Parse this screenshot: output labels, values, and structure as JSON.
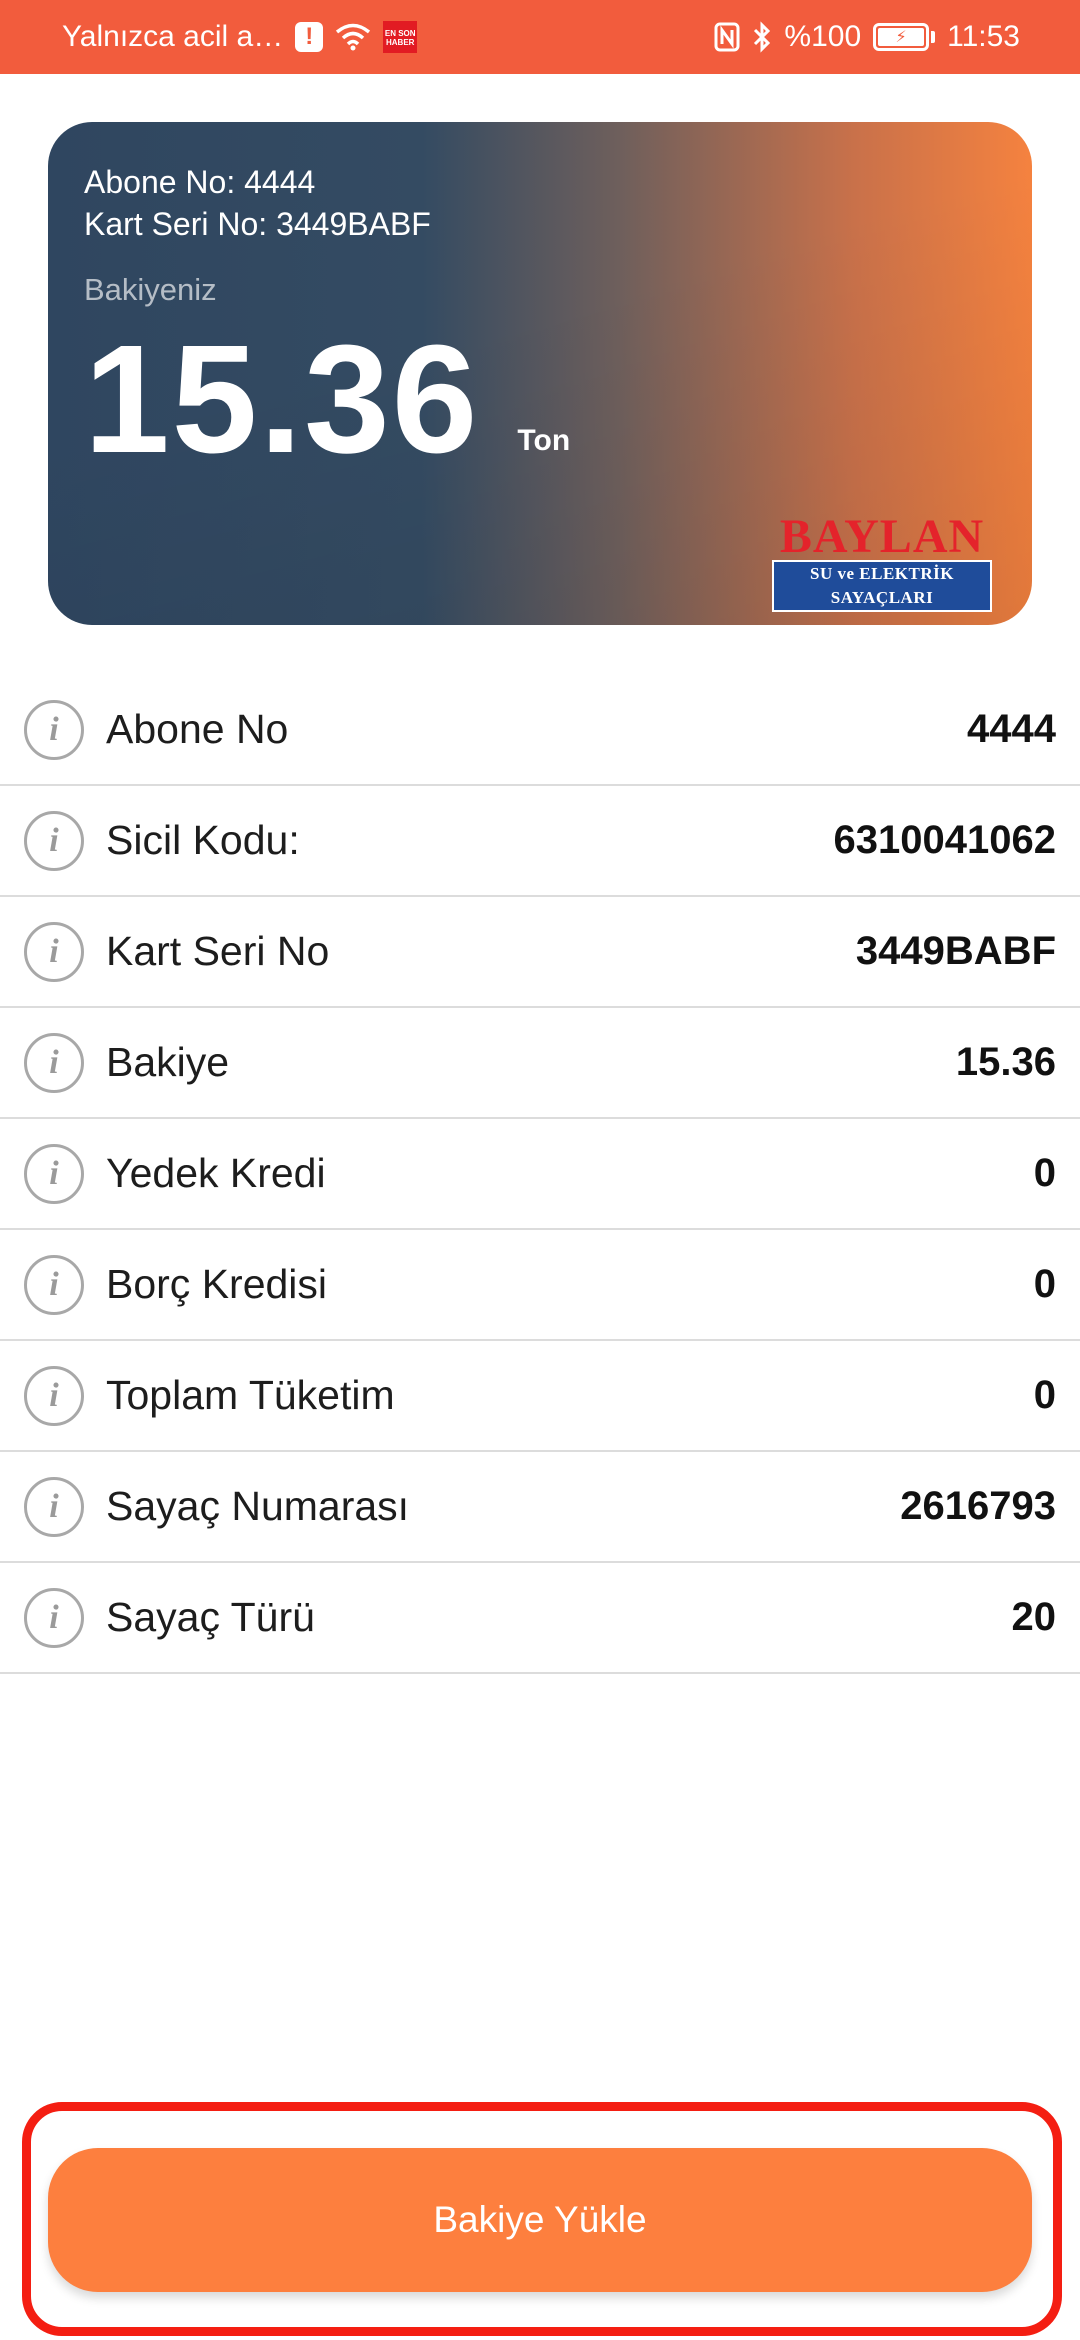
{
  "status_bar": {
    "carrier_text": "Yalnızca acil a…",
    "news_badge": "EN SON HABER",
    "battery_text": "%100",
    "time": "11:53",
    "icons": [
      "alert-icon",
      "wifi-icon",
      "nfc-icon",
      "bluetooth-icon",
      "battery-icon"
    ]
  },
  "card": {
    "subscriber_line": "Abone No: 4444",
    "card_serial_line": "Kart Seri No: 3449BABF",
    "balance_label": "Bakiyeniz",
    "balance_value": "15.36",
    "balance_unit": "Ton",
    "brand_name": "BAYLAN",
    "brand_subtitle": "SU ve ELEKTRİK SAYAÇLARI",
    "colors": {
      "gradient_start": "#2f4660",
      "gradient_end": "#f5823f"
    }
  },
  "info_rows": [
    {
      "label": "Abone No",
      "value": "4444"
    },
    {
      "label": "Sicil Kodu:",
      "value": "6310041062"
    },
    {
      "label": "Kart Seri No",
      "value": "3449BABF"
    },
    {
      "label": "Bakiye",
      "value": "15.36"
    },
    {
      "label": "Yedek Kredi",
      "value": "0"
    },
    {
      "label": "Borç Kredisi",
      "value": "0"
    },
    {
      "label": "Toplam Tüketim",
      "value": "0"
    },
    {
      "label": "Sayaç Numarası",
      "value": "2616793"
    },
    {
      "label": "Sayaç Türü",
      "value": "20"
    }
  ],
  "info_icon_glyph": "i",
  "actions": {
    "load_balance_label": "Bakiye Yükle",
    "accent_color": "#fd7f3e",
    "highlight_color": "#f41e12"
  }
}
